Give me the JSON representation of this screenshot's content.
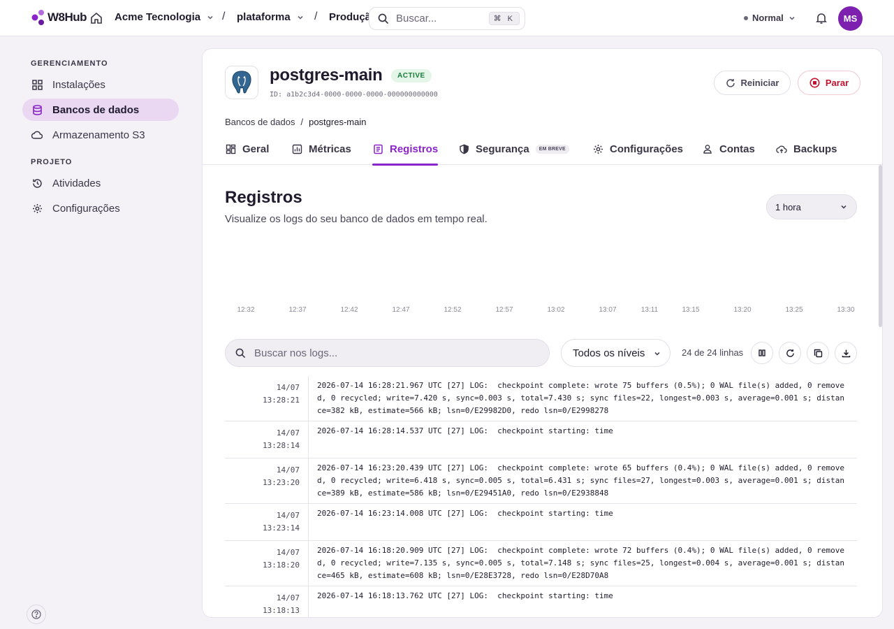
{
  "app": {
    "name": "W8Hub"
  },
  "colors": {
    "accent": "#8a24c8",
    "active_badge": "#1a7a3a",
    "stop": "#c8102e",
    "avatar": "#7d20b0"
  },
  "topbar": {
    "org": "Acme Tecnologia",
    "sep1": "/",
    "project": "plataforma",
    "sep2": "/",
    "env": "Produçã",
    "search_placeholder": "Buscar...",
    "shortcut": "⌘ K",
    "mode": "Normal",
    "avatar_initials": "MS"
  },
  "sidebar": {
    "section1": "GERENCIAMENTO",
    "items1": [
      {
        "label": "Instalações",
        "icon": "grid-icon"
      },
      {
        "label": "Bancos de dados",
        "icon": "database-icon",
        "active": true
      },
      {
        "label": "Armazenamento S3",
        "icon": "cloud-icon"
      }
    ],
    "section2": "PROJETO",
    "items2": [
      {
        "label": "Atividades",
        "icon": "history-icon"
      },
      {
        "label": "Configurações",
        "icon": "gear-icon"
      }
    ]
  },
  "database": {
    "name": "postgres-main",
    "status": "ACTIVE",
    "id": "ID: a1b2c3d4-0000-0000-0000-000000000000",
    "restart_label": "Reiniciar",
    "stop_label": "Parar"
  },
  "breadcrumb": {
    "parent": "Bancos de dados",
    "sep": "/",
    "current": "postgres-main"
  },
  "tabs": [
    {
      "label": "Geral",
      "icon": "overview-icon"
    },
    {
      "label": "Métricas",
      "icon": "chart-icon"
    },
    {
      "label": "Registros",
      "icon": "logs-icon",
      "active": true
    },
    {
      "label": "Segurança",
      "icon": "shield-icon",
      "badge": "EM BREVE"
    },
    {
      "label": "Configurações",
      "icon": "gear-icon"
    },
    {
      "label": "Contas",
      "icon": "user-icon"
    },
    {
      "label": "Backups",
      "icon": "cloud-upload-icon"
    }
  ],
  "logs": {
    "title": "Registros",
    "subtitle": "Visualize os logs do seu banco de dados em tempo real.",
    "time_range": "1 hora",
    "time_ticks": [
      "12:32",
      "12:37",
      "12:42",
      "12:47",
      "12:52",
      "12:57",
      "13:02",
      "13:07",
      "13:11",
      "13:15",
      "13:20",
      "13:25",
      "13:30"
    ],
    "search_placeholder": "Buscar nos logs...",
    "level_filter": "Todos os níveis",
    "count_text": "24 de 24 linhas",
    "rows": [
      {
        "date": "14/07",
        "time": "13:28:21",
        "message": "2026-07-14 16:28:21.967 UTC [27] LOG:  checkpoint complete: wrote 75 buffers (0.5%); 0 WAL file(s) added, 0 removed, 0 recycled; write=7.420 s, sync=0.003 s, total=7.430 s; sync files=22, longest=0.003 s, average=0.001 s; distance=382 kB, estimate=566 kB; lsn=0/E29982D0, redo lsn=0/E2998278"
      },
      {
        "date": "14/07",
        "time": "13:28:14",
        "message": "2026-07-14 16:28:14.537 UTC [27] LOG:  checkpoint starting: time"
      },
      {
        "date": "14/07",
        "time": "13:23:20",
        "message": "2026-07-14 16:23:20.439 UTC [27] LOG:  checkpoint complete: wrote 65 buffers (0.4%); 0 WAL file(s) added, 0 removed, 0 recycled; write=6.418 s, sync=0.005 s, total=6.431 s; sync files=27, longest=0.003 s, average=0.001 s; distance=389 kB, estimate=586 kB; lsn=0/E29451A0, redo lsn=0/E2938848"
      },
      {
        "date": "14/07",
        "time": "13:23:14",
        "message": "2026-07-14 16:23:14.008 UTC [27] LOG:  checkpoint starting: time"
      },
      {
        "date": "14/07",
        "time": "13:18:20",
        "message": "2026-07-14 16:18:20.909 UTC [27] LOG:  checkpoint complete: wrote 72 buffers (0.4%); 0 WAL file(s) added, 0 removed, 0 recycled; write=7.135 s, sync=0.005 s, total=7.148 s; sync files=25, longest=0.004 s, average=0.001 s; distance=465 kB, estimate=608 kB; lsn=0/E28E3728, redo lsn=0/E28D70A8"
      },
      {
        "date": "14/07",
        "time": "13:18:13",
        "message": "2026-07-14 16:18:13.762 UTC [27] LOG:  checkpoint starting: time"
      }
    ]
  }
}
